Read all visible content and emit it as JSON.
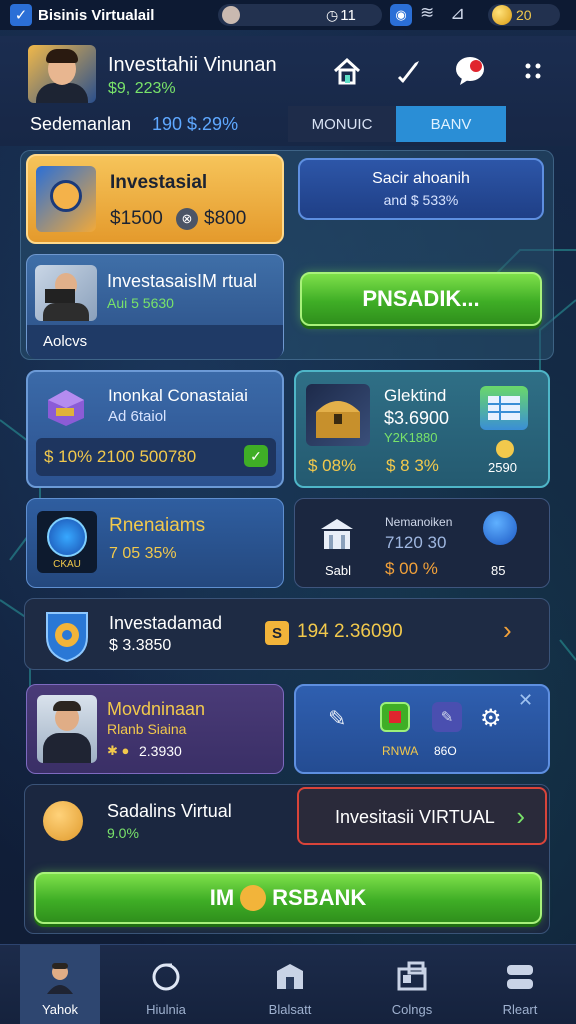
{
  "status_bar": {
    "app_name": "Bisinis Virtualail",
    "time": "11",
    "coins": "20"
  },
  "header": {
    "user_name": "Investtahii Vinunan",
    "user_stat": "$9, 223%",
    "balance_label": "Sedemanlan",
    "balance_value": "190 $.29%",
    "tabs": [
      "MONUIC",
      "BANV"
    ]
  },
  "cards": {
    "investasi": {
      "title": "Investasial",
      "left_value": "$1500",
      "right_value": "$800"
    },
    "saldo": {
      "line1": "Sacir ahoanih",
      "line2": "and $ 533%"
    },
    "virtual": {
      "title": "InvestasaisIM rtual",
      "sub": "Aui 5 5630",
      "footer": "Aolcvs"
    },
    "pnsadik_button": "PNSADIK...",
    "konsultasi": {
      "title": "Inonkal Conastaiai",
      "sub": "Ad 6taiol",
      "row": "$ 10% 2100 500780"
    },
    "glektind": {
      "title": "Glektind",
      "value": "$3.6900",
      "sub": "Y2K1880",
      "p1": "$ 08%",
      "p2": "$ 8 3%",
      "p3": "2590"
    },
    "rnenaiams": {
      "title": "Rnenaiams",
      "value": "7 05 35%",
      "icon_label": "CKAU"
    },
    "nemanokan": {
      "title": "Nemanoiken",
      "value": "7120 30",
      "left": "Sabl",
      "pct": "$ 00 %",
      "right": "85"
    },
    "investadamad": {
      "title": "Investadamad",
      "value": "$ 3.3850",
      "badge": "S",
      "stat": "194 2.36090"
    },
    "movdninaan": {
      "title": "Movdninaan",
      "sub": "Rlanb Siaina",
      "value": "2.3930"
    },
    "tools": {
      "label_a": "RNWA",
      "label_b": "86O"
    },
    "sadalins": {
      "title": "Sadalins Virtual",
      "value": "9.0%"
    },
    "virtual_button": "Invesitasii VIRTUAL",
    "bank_button_left": "IM",
    "bank_button_right": "RSBANK"
  },
  "nav": [
    {
      "label": "Yahok"
    },
    {
      "label": "Hiulnia"
    },
    {
      "label": "Blalsatt"
    },
    {
      "label": "Colngs"
    },
    {
      "label": "Rleart"
    }
  ],
  "colors": {
    "accent_green": "#79e36a",
    "accent_blue": "#2a8ed6",
    "gold": "#f0b84a",
    "red_outline": "#d9443a"
  }
}
